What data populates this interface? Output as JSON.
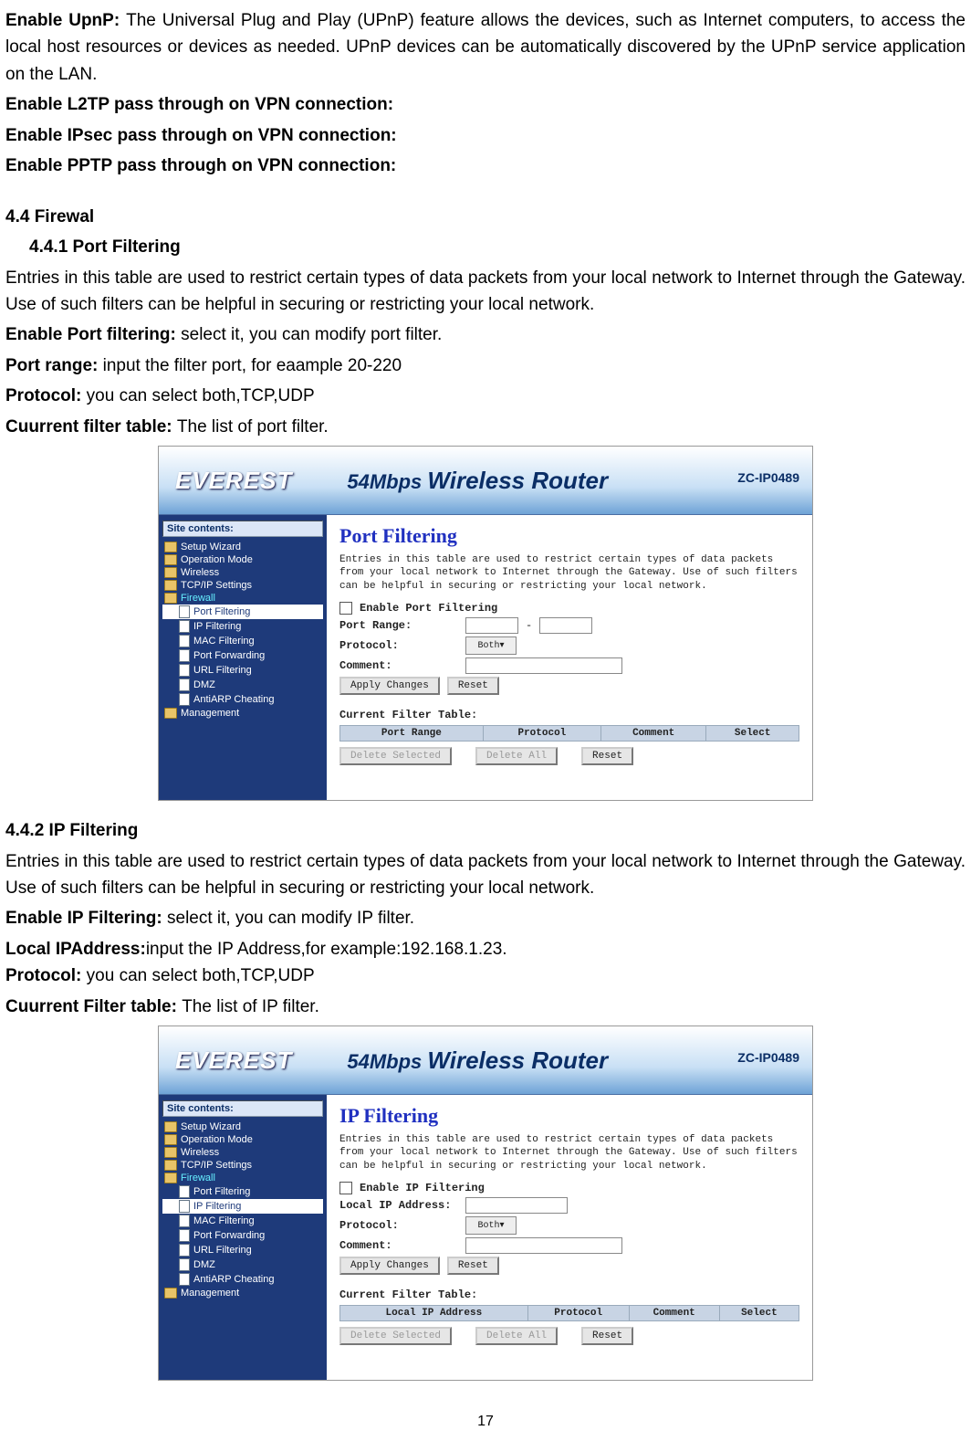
{
  "text": {
    "upnp_label": "Enable UpnP: ",
    "upnp_body": "The Universal Plug and Play (UPnP) feature allows the devices, such as Internet computers, to access the local host resources or devices as needed. UPnP devices can be  automatically discovered by the UPnP service application on the LAN.",
    "l2tp": "Enable L2TP pass through on VPN connection:",
    "ipsec": "Enable IPsec pass through on VPN connection:",
    "pptp": "Enable PPTP pass through on VPN connection:",
    "s44": "4.4 Firewal",
    "s441": "4.4.1 Port Filtering",
    "pf_intro": "Entries in this table are used to restrict certain types of data packets from your local network to Internet through the Gateway. Use of such filters can be helpful in securing or restricting your local network.",
    "pf_en_l": "Enable Port filtering: ",
    "pf_en_b": "select it, you can modify port filter.",
    "pf_pr_l": "Port range: ",
    "pf_pr_b": "input the filter port, for eaample 20-220",
    "pf_pro_l": "Protocol: ",
    "pf_pro_b": "you can select both,TCP,UDP",
    "pf_ct_l": "Cuurrent filter table: ",
    "pf_ct_b": "The list of port filter.",
    "s442": "4.4.2   IP Filtering",
    "ip_intro": "Entries in this table are used to restrict certain types of data packets from your local network to Internet through the Gateway. Use of such filters can be helpful in securing or restricting your local network.",
    "ip_en_l": "Enable IP Filtering: ",
    "ip_en_b": "select it, you can modify IP filter.",
    "ip_la_l": "Local IPAddress:",
    "ip_la_b": "input the IP Address,for example:192.168.1.23.",
    "ip_pro_l": "Protocol: ",
    "ip_pro_b": "you can select both,TCP,UDP",
    "ip_ct_l": "Cuurrent Filter table: ",
    "ip_ct_b": "The list of IP filter.",
    "page_num": "17"
  },
  "fig1": {
    "logo": "EVEREST",
    "header": "54Mbps",
    "header2": "Wireless Router",
    "model": "ZC-IP0489",
    "side_title": "Site contents:",
    "side_items": [
      "Setup Wizard",
      "Operation Mode",
      "Wireless",
      "TCP/IP Settings",
      "Firewall",
      "Port Filtering",
      "IP Filtering",
      "MAC Filtering",
      "Port Forwarding",
      "URL Filtering",
      "DMZ",
      "AntiARP Cheating",
      "Management"
    ],
    "title": "Port Filtering",
    "desc": "Entries in this table are used to restrict certain types of data packets from your local network to Internet through the Gateway. Use of such filters can be helpful in securing or restricting your local network.",
    "enable_label": "Enable Port Filtering",
    "port_range": "Port Range:",
    "protocol": "Protocol:",
    "protocol_val": "Both",
    "comment": "Comment:",
    "apply": "Apply Changes",
    "reset": "Reset",
    "table_caption": "Current Filter Table:",
    "th": [
      "Port Range",
      "Protocol",
      "Comment",
      "Select"
    ],
    "del_sel": "Delete Selected",
    "del_all": "Delete All",
    "reset2": "Reset"
  },
  "fig2": {
    "logo": "EVEREST",
    "header": "54Mbps",
    "header2": "Wireless Router",
    "model": "ZC-IP0489",
    "side_title": "Site contents:",
    "side_items": [
      "Setup Wizard",
      "Operation Mode",
      "Wireless",
      "TCP/IP Settings",
      "Firewall",
      "Port Filtering",
      "IP Filtering",
      "MAC Filtering",
      "Port Forwarding",
      "URL Filtering",
      "DMZ",
      "AntiARP Cheating",
      "Management"
    ],
    "title": "IP Filtering",
    "desc": "Entries in this table are used to restrict certain types of data packets from your local network to Internet through the Gateway. Use of such filters can be helpful in securing or restricting your local network.",
    "enable_label": "Enable IP Filtering",
    "local_ip": "Local IP Address:",
    "protocol": "Protocol:",
    "protocol_val": "Both",
    "comment": "Comment:",
    "apply": "Apply Changes",
    "reset": "Reset",
    "table_caption": "Current Filter Table:",
    "th": [
      "Local IP Address",
      "Protocol",
      "Comment",
      "Select"
    ],
    "del_sel": "Delete Selected",
    "del_all": "Delete All",
    "reset2": "Reset"
  }
}
